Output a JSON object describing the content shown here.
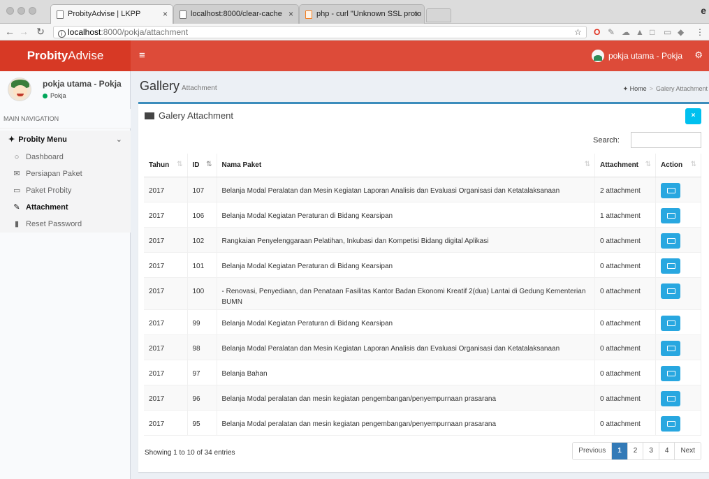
{
  "browser": {
    "tabs": [
      {
        "title": "ProbityAdvise | LKPP"
      },
      {
        "title": "localhost:8000/clear-cache"
      },
      {
        "title": "php - curl \"Unknown SSL proto"
      }
    ],
    "url_host": "localhost",
    "url_rest": ":8000/pokja/attachment"
  },
  "app": {
    "logo_bold": "Probity",
    "logo_rest": "Advise",
    "user_top": "pokja utama - Pokja"
  },
  "sidebar": {
    "user_name": "pokja utama - Pokja",
    "user_status": "Pokja",
    "nav_header": "MAIN NAVIGATION",
    "menu_title": "Probity Menu",
    "items": [
      {
        "label": "Dashboard",
        "icon": "circle-icon"
      },
      {
        "label": "Persiapan Paket",
        "icon": "envelope-icon"
      },
      {
        "label": "Paket Probity",
        "icon": "inbox-icon"
      },
      {
        "label": "Attachment",
        "icon": "edit-icon"
      },
      {
        "label": "Reset Password",
        "icon": "lock-icon"
      }
    ]
  },
  "content": {
    "title": "Gallery",
    "subtitle": "Attachment",
    "breadcrumb_home": "Home",
    "breadcrumb_current": "Galery Attachment"
  },
  "box": {
    "title": "Galery Attachment",
    "close_label": "×",
    "search_label": "Search:"
  },
  "table": {
    "headers": [
      "Tahun",
      "ID",
      "Nama Paket",
      "Attachment",
      "Action"
    ],
    "rows": [
      {
        "tahun": "2017",
        "id": "107",
        "nama": "Belanja Modal Peralatan dan Mesin Kegiatan Laporan Analisis dan Evaluasi Organisasi dan Ketatalaksanaan",
        "attachment": "2 attachment"
      },
      {
        "tahun": "2017",
        "id": "106",
        "nama": "Belanja Modal Kegiatan Peraturan di Bidang Kearsipan",
        "attachment": "1 attachment"
      },
      {
        "tahun": "2017",
        "id": "102",
        "nama": "Rangkaian Penyelenggaraan Pelatihan, Inkubasi dan Kompetisi Bidang digital Aplikasi",
        "attachment": "0 attachment"
      },
      {
        "tahun": "2017",
        "id": "101",
        "nama": "Belanja Modal Kegiatan Peraturan di Bidang Kearsipan",
        "attachment": "0 attachment"
      },
      {
        "tahun": "2017",
        "id": "100",
        "nama": "- Renovasi, Penyediaan, dan Penataan Fasilitas Kantor Badan Ekonomi Kreatif 2(dua) Lantai di Gedung Kementerian BUMN",
        "attachment": "0 attachment"
      },
      {
        "tahun": "2017",
        "id": "99",
        "nama": "Belanja Modal Kegiatan Peraturan di Bidang Kearsipan",
        "attachment": "0 attachment"
      },
      {
        "tahun": "2017",
        "id": "98",
        "nama": "Belanja Modal Peralatan dan Mesin Kegiatan Laporan Analisis dan Evaluasi Organisasi dan Ketatalaksanaan",
        "attachment": "0 attachment"
      },
      {
        "tahun": "2017",
        "id": "97",
        "nama": "Belanja Bahan",
        "attachment": "0 attachment"
      },
      {
        "tahun": "2017",
        "id": "96",
        "nama": "Belanja Modal peralatan dan mesin kegiatan pengembangan/penyempurnaan prasarana",
        "attachment": "0 attachment"
      },
      {
        "tahun": "2017",
        "id": "95",
        "nama": "Belanja Modal peralatan dan mesin kegiatan pengembangan/penyempurnaan prasarana",
        "attachment": "0 attachment"
      }
    ]
  },
  "footer": {
    "info": "Showing 1 to 10 of 34 entries",
    "pager": [
      "Previous",
      "1",
      "2",
      "3",
      "4",
      "Next"
    ],
    "current_page": "1"
  }
}
